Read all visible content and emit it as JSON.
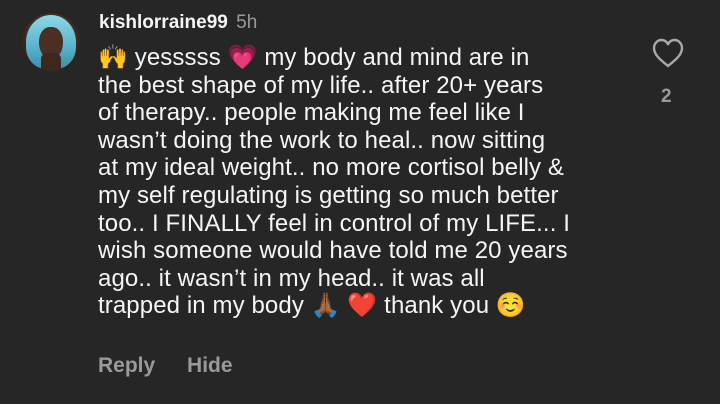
{
  "comment": {
    "username": "kishlorraine99",
    "time": "5h",
    "avatar_icon": "profile-photo",
    "lines": [
      "🙌 yesssss 💗 my body and mind are in",
      "the best shape of my life.. after 20+ years",
      "of therapy.. people making me feel like I",
      "wasn’t doing the work to heal.. now sitting",
      "at my ideal weight.. no more cortisol belly &",
      "my self regulating is getting so much better",
      "too.. I FINALLY feel in control of my LIFE... I",
      "wish someone would have told me 20 years",
      "ago.. it wasn’t in my head.. it was all",
      "trapped in my body 🙏🏾 ❤️ thank you ☺️"
    ],
    "like_count": "2",
    "actions": {
      "reply": "Reply",
      "hide": "Hide"
    }
  },
  "colors": {
    "background": "#262626",
    "primary_text": "#f5f5f5",
    "secondary_text": "#9a9a9a",
    "heart_outline": "#a8a8a8"
  },
  "icons": {
    "like": "heart-outline-icon"
  }
}
